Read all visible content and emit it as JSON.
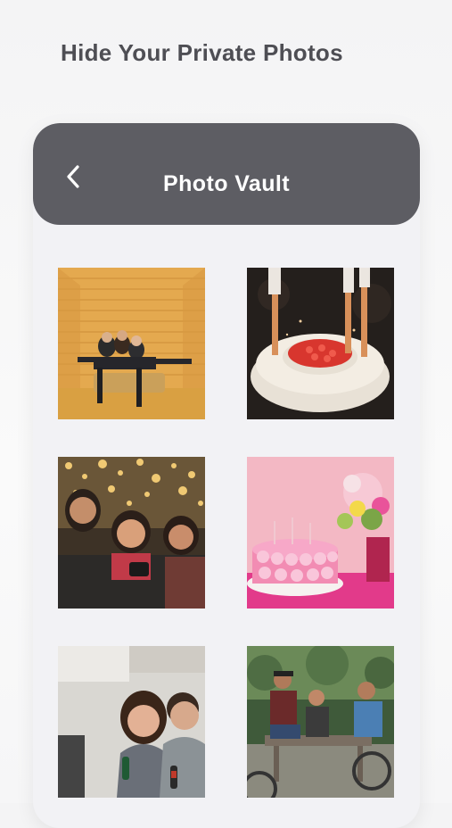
{
  "headline": "Hide Your Private Photos",
  "header": {
    "title": "Photo Vault",
    "back_icon": "chevron-left-icon"
  },
  "photos": [
    {
      "name": "photo-friends-orange-room"
    },
    {
      "name": "photo-birthday-cake-candles"
    },
    {
      "name": "photo-friends-selfie-lights"
    },
    {
      "name": "photo-pink-cake-flowers"
    },
    {
      "name": "photo-friends-laughing"
    },
    {
      "name": "photo-friends-picnic-table"
    }
  ],
  "colors": {
    "header_bg": "#5d5d63",
    "card_bg": "#f2f2f5",
    "headline_text": "#4e4e54"
  }
}
